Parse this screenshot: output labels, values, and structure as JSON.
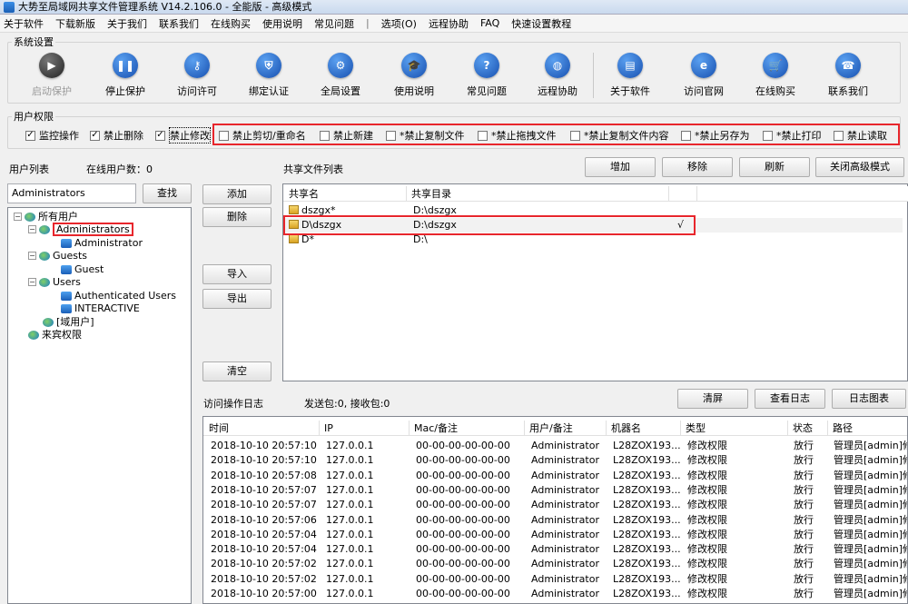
{
  "window": {
    "title": "大势至局域网共享文件管理系统 V14.2.106.0 - 全能版 - 高级模式"
  },
  "menu": [
    "关于软件",
    "下载新版",
    "关于我们",
    "联系我们",
    "在线购买",
    "使用说明",
    "常见问题",
    "|",
    "选项(O)",
    "远程协助",
    "FAQ",
    "快速设置教程"
  ],
  "system": {
    "legend": "系统设置",
    "toolbar": [
      {
        "label": "启动保护",
        "icon": "play-icon"
      },
      {
        "label": "停止保护",
        "icon": "pause-icon"
      },
      {
        "label": "访问许可",
        "icon": "key-icon"
      },
      {
        "label": "绑定认证",
        "icon": "shield-icon"
      },
      {
        "label": "全局设置",
        "icon": "gear-icon"
      },
      {
        "label": "使用说明",
        "icon": "graduation-cap-icon"
      },
      {
        "label": "常见问题",
        "icon": "question-icon"
      },
      {
        "label": "远程协助",
        "icon": "globe-icon"
      },
      {
        "label": "关于软件",
        "icon": "document-icon"
      },
      {
        "label": "访问官网",
        "icon": "browser-icon"
      },
      {
        "label": "在线购买",
        "icon": "cart-icon"
      },
      {
        "label": "联系我们",
        "icon": "phone-icon"
      }
    ]
  },
  "permissions": {
    "legend": "用户权限",
    "items": [
      {
        "label": "监控操作",
        "checked": true
      },
      {
        "label": "禁止删除",
        "checked": true
      },
      {
        "label": "禁止修改",
        "checked": true
      },
      {
        "label": "禁止剪切/重命名",
        "checked": false
      },
      {
        "label": "禁止新建",
        "checked": false
      },
      {
        "label": "*禁止复制文件",
        "checked": false
      },
      {
        "label": "*禁止拖拽文件",
        "checked": false
      },
      {
        "label": "*禁止复制文件内容",
        "checked": false
      },
      {
        "label": "*禁止另存为",
        "checked": false
      },
      {
        "label": "*禁止打印",
        "checked": false
      },
      {
        "label": "禁止读取",
        "checked": false
      }
    ]
  },
  "userlist": {
    "title": "用户列表",
    "online_label": "在线用户数：0",
    "search_value": "Administrators",
    "search_button": "查找",
    "tree": [
      "所有用户",
      "Administrators",
      "Administrator",
      "Guests",
      "Guest",
      "Users",
      "Authenticated Users",
      "INTERACTIVE",
      "[域用户]",
      "来宾权限"
    ]
  },
  "mid_buttons": {
    "add": "添加",
    "delete": "删除",
    "import": "导入",
    "export": "导出",
    "clear": "清空"
  },
  "shares": {
    "title": "共享文件列表",
    "buttons": {
      "add": "增加",
      "remove": "移除",
      "refresh": "刷新",
      "close_advanced": "关闭高级模式"
    },
    "columns": [
      "共享名",
      "共享目录"
    ],
    "rows": [
      {
        "name": "dszgx*",
        "dir": "D:\\dszgx",
        "mark": ""
      },
      {
        "name": "D\\dszgx",
        "dir": "D:\\dszgx",
        "mark": "√"
      },
      {
        "name": "D*",
        "dir": "D:\\",
        "mark": ""
      }
    ]
  },
  "log": {
    "title": "访问操作日志",
    "packets": "发送包:0, 接收包:0",
    "buttons": {
      "clear": "清屏",
      "view": "查看日志",
      "chart": "日志图表"
    },
    "columns": [
      "时间",
      "IP",
      "Mac/备注",
      "用户/备注",
      "机器名",
      "类型",
      "状态",
      "路径"
    ],
    "rows": [
      [
        "2018-10-10 20:57:10",
        "127.0.0.1",
        "00-00-00-00-00-00",
        "Administrator",
        "L28ZOX193...",
        "修改权限",
        "放行",
        "管理员[admin]修改"
      ],
      [
        "2018-10-10 20:57:10",
        "127.0.0.1",
        "00-00-00-00-00-00",
        "Administrator",
        "L28ZOX193...",
        "修改权限",
        "放行",
        "管理员[admin]修改"
      ],
      [
        "2018-10-10 20:57:08",
        "127.0.0.1",
        "00-00-00-00-00-00",
        "Administrator",
        "L28ZOX193...",
        "修改权限",
        "放行",
        "管理员[admin]修改"
      ],
      [
        "2018-10-10 20:57:07",
        "127.0.0.1",
        "00-00-00-00-00-00",
        "Administrator",
        "L28ZOX193...",
        "修改权限",
        "放行",
        "管理员[admin]修改"
      ],
      [
        "2018-10-10 20:57:07",
        "127.0.0.1",
        "00-00-00-00-00-00",
        "Administrator",
        "L28ZOX193...",
        "修改权限",
        "放行",
        "管理员[admin]修改"
      ],
      [
        "2018-10-10 20:57:06",
        "127.0.0.1",
        "00-00-00-00-00-00",
        "Administrator",
        "L28ZOX193...",
        "修改权限",
        "放行",
        "管理员[admin]修改"
      ],
      [
        "2018-10-10 20:57:04",
        "127.0.0.1",
        "00-00-00-00-00-00",
        "Administrator",
        "L28ZOX193...",
        "修改权限",
        "放行",
        "管理员[admin]修改"
      ],
      [
        "2018-10-10 20:57:04",
        "127.0.0.1",
        "00-00-00-00-00-00",
        "Administrator",
        "L28ZOX193...",
        "修改权限",
        "放行",
        "管理员[admin]修改"
      ],
      [
        "2018-10-10 20:57:02",
        "127.0.0.1",
        "00-00-00-00-00-00",
        "Administrator",
        "L28ZOX193...",
        "修改权限",
        "放行",
        "管理员[admin]修改"
      ],
      [
        "2018-10-10 20:57:02",
        "127.0.0.1",
        "00-00-00-00-00-00",
        "Administrator",
        "L28ZOX193...",
        "修改权限",
        "放行",
        "管理员[admin]修改"
      ],
      [
        "2018-10-10 20:57:00",
        "127.0.0.1",
        "00-00-00-00-00-00",
        "Administrator",
        "L28ZOX193...",
        "修改权限",
        "放行",
        "管理员[admin]修改"
      ]
    ]
  },
  "colors": {
    "highlight": "#e8262c",
    "icon_blue": "#1a5eb8"
  }
}
